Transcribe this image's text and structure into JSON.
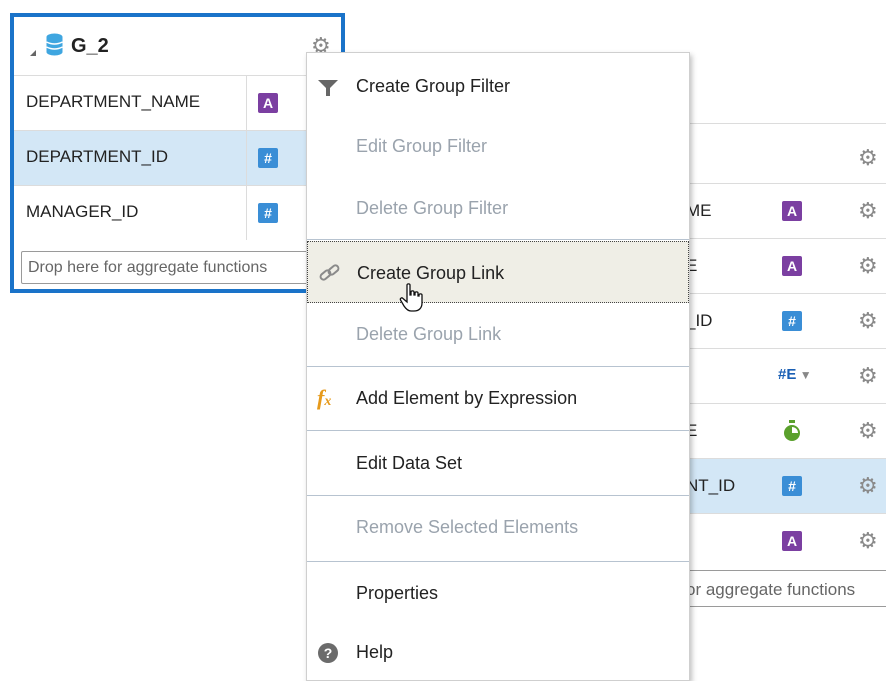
{
  "group": {
    "title": "G_2",
    "rows": [
      {
        "name": "DEPARTMENT_NAME",
        "type": "A",
        "selected": false
      },
      {
        "name": "DEPARTMENT_ID",
        "type": "#",
        "selected": true
      },
      {
        "name": "MANAGER_ID",
        "type": "#",
        "selected": false
      }
    ],
    "drop_placeholder": "Drop here for aggregate functions"
  },
  "background_group": {
    "rows": [
      {
        "text": "ME",
        "type": "A",
        "selected": false
      },
      {
        "text": "E",
        "type": "A",
        "selected": false
      },
      {
        "text": "_ID",
        "type": "#",
        "selected": false
      },
      {
        "text": "",
        "type": "#E",
        "selected": false
      },
      {
        "text": "E",
        "type": "timer",
        "selected": false
      },
      {
        "text": "NT_ID",
        "type": "#",
        "selected": true
      },
      {
        "text": "",
        "type": "A",
        "selected": false
      }
    ],
    "drop_placeholder": "or aggregate functions"
  },
  "context_menu": {
    "items": [
      {
        "label": "Create Group Filter",
        "enabled": true,
        "icon": "filter-icon"
      },
      {
        "label": "Edit Group Filter",
        "enabled": false,
        "icon": ""
      },
      {
        "label": "Delete Group Filter",
        "enabled": false,
        "icon": ""
      },
      {
        "label": "Create Group Link",
        "enabled": true,
        "icon": "link-icon",
        "highlighted": true
      },
      {
        "label": "Delete Group Link",
        "enabled": false,
        "icon": ""
      },
      {
        "label": "Add Element by Expression",
        "enabled": true,
        "icon": "fx-icon"
      },
      {
        "label": "Edit Data Set",
        "enabled": true,
        "icon": ""
      },
      {
        "label": "Remove Selected Elements",
        "enabled": false,
        "icon": ""
      },
      {
        "label": "Properties",
        "enabled": true,
        "icon": ""
      },
      {
        "label": "Help",
        "enabled": true,
        "icon": "help-icon"
      }
    ]
  },
  "colors": {
    "group_border": "#1a73c9",
    "selected_row": "#d3e7f6",
    "badge_text": "#7b3fa1",
    "badge_number": "#3a8ed6",
    "disabled_text": "#9aa3ad",
    "menu_highlight": "#efeee6"
  }
}
